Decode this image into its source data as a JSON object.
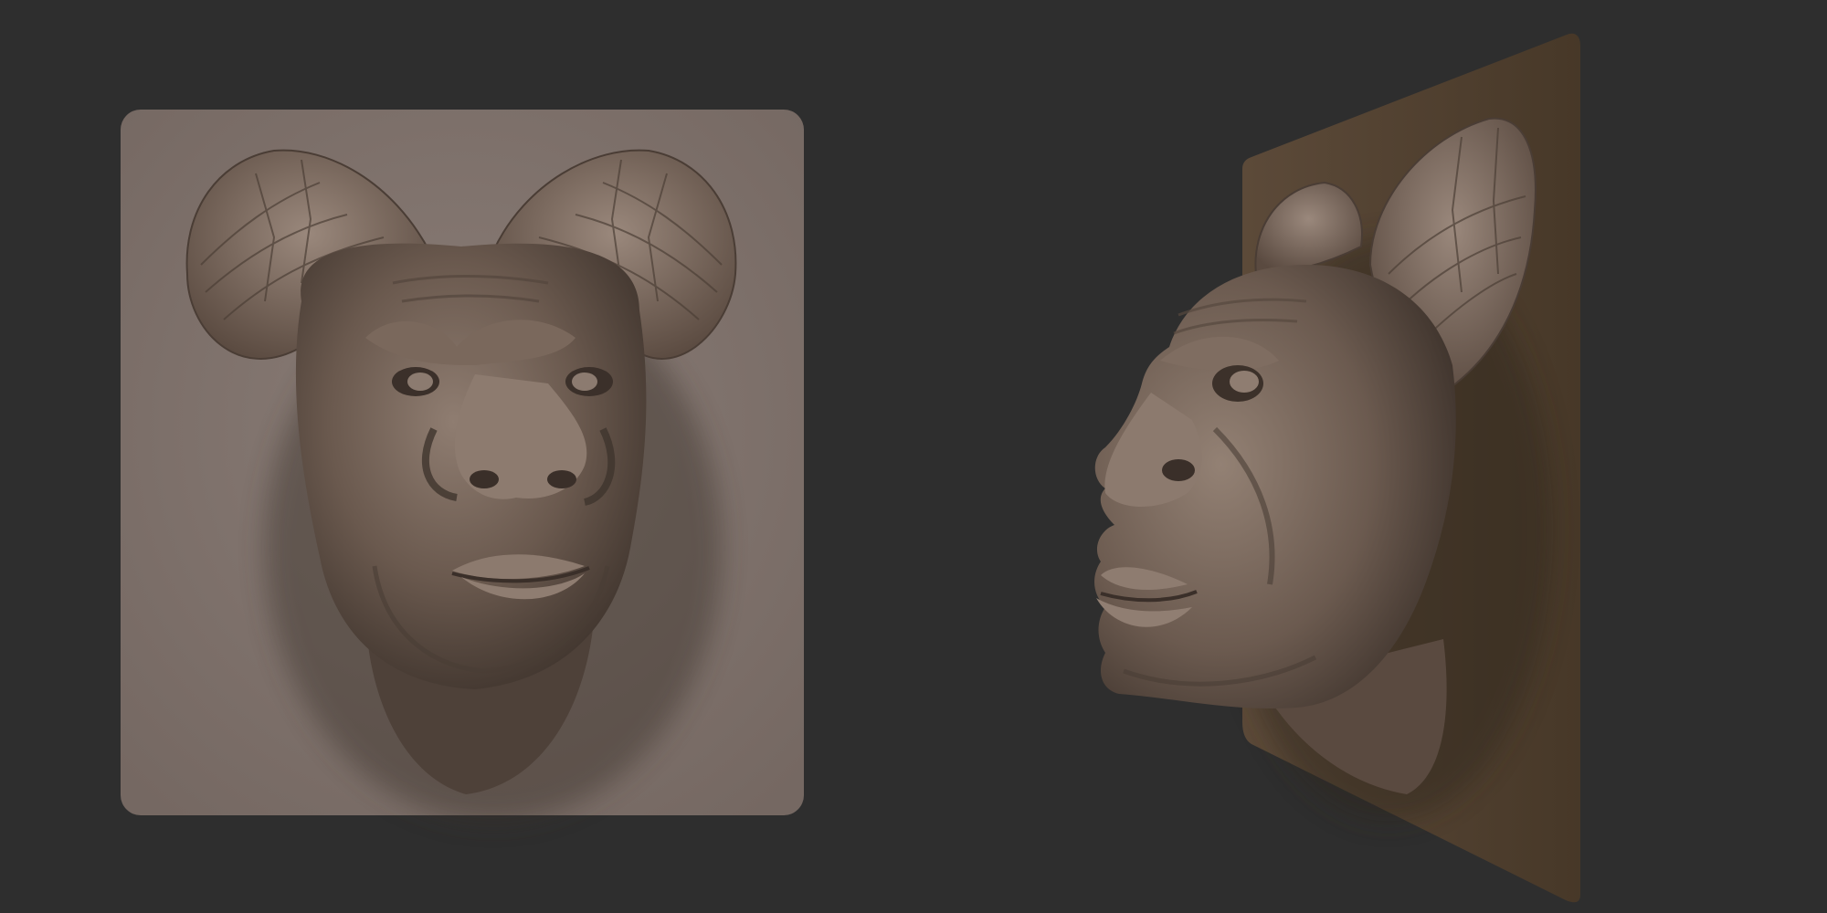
{
  "scene": {
    "background_color": "#2e2e2e",
    "material_color": "#8a786c",
    "front_plate_color": "#7d6f68",
    "side_plate_color": "#4e3f31",
    "views": [
      {
        "name": "front-view"
      },
      {
        "name": "three-quarter-view"
      }
    ]
  }
}
